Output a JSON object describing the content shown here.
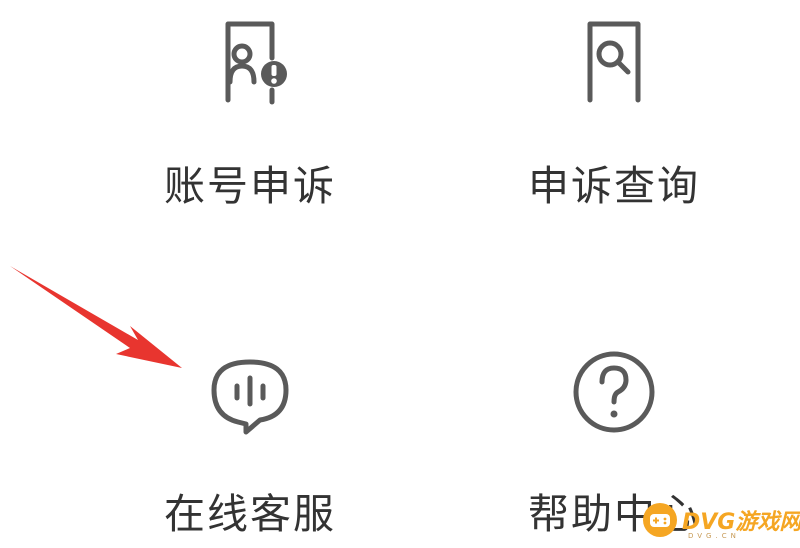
{
  "menu": {
    "items": [
      {
        "label": "账号申诉",
        "icon": "account-appeal-icon"
      },
      {
        "label": "申诉查询",
        "icon": "appeal-query-icon"
      },
      {
        "label": "在线客服",
        "icon": "online-service-icon"
      },
      {
        "label": "帮助中心",
        "icon": "help-center-icon"
      }
    ]
  },
  "annotation": {
    "arrow_icon": "red-pointer-arrow-icon",
    "arrow_color": "#e8352f"
  },
  "watermark": {
    "text": "DVG游戏网",
    "sub": "DVG.CN",
    "color": "#f5a623"
  },
  "colors": {
    "icon_stroke": "#5a5a5a",
    "label_text": "#333333",
    "background": "#ffffff"
  }
}
